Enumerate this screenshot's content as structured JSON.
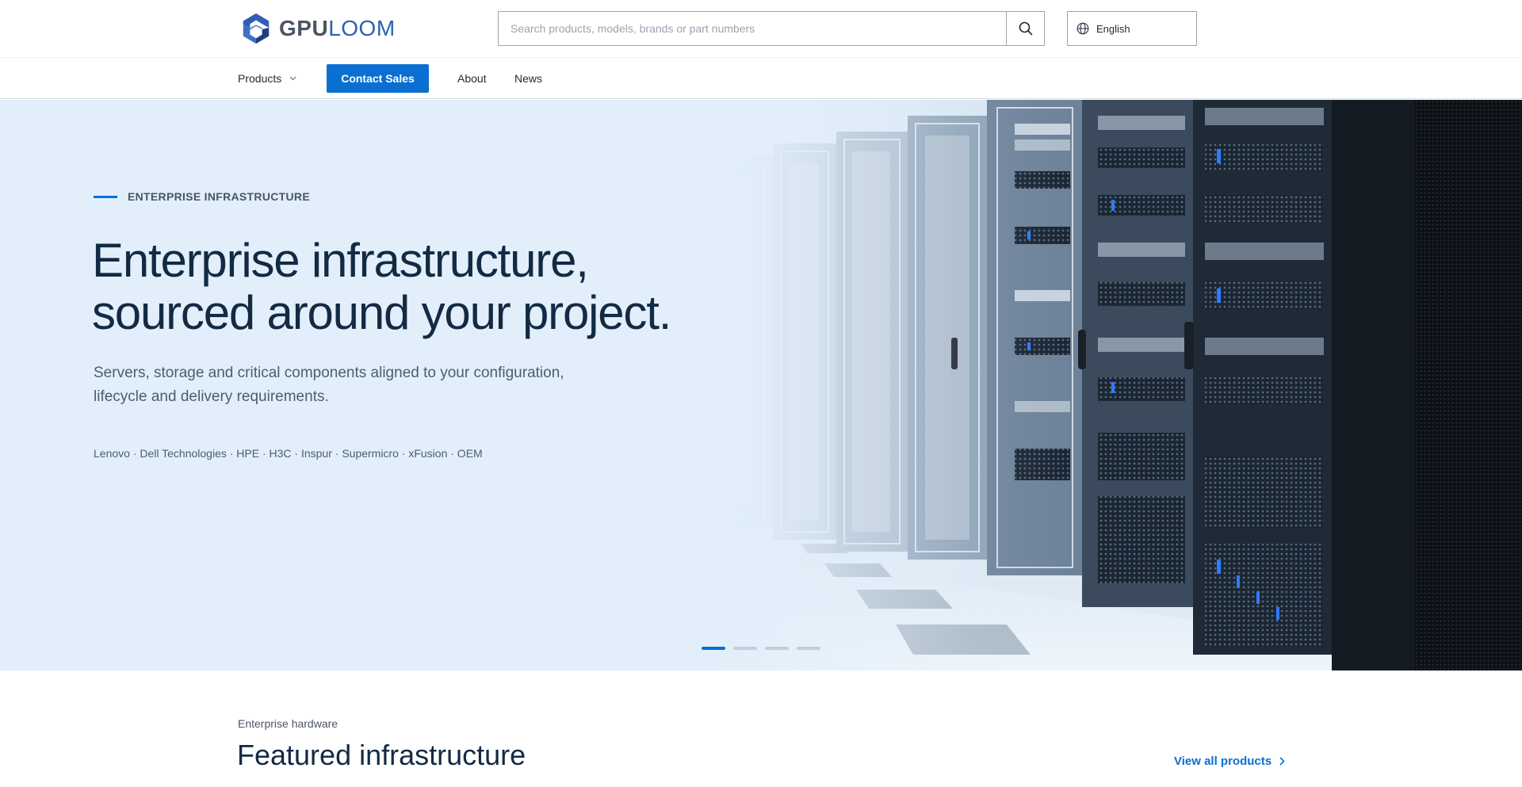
{
  "brand": {
    "logo_part1": "GPU",
    "logo_part2": "LOOM",
    "colors": {
      "primary": "#0a6fd1",
      "logo_dark": "#4b5563",
      "logo_blue": "#2f5fb3",
      "hero_bg": "#e2effa"
    }
  },
  "search": {
    "placeholder": "Search products, models, brands or part numbers",
    "value": "",
    "icon": "search-icon"
  },
  "language": {
    "selected": "English",
    "icon": "globe-icon"
  },
  "nav": {
    "products_label": "Products",
    "products_icon": "chevron-down-icon",
    "contact_label": "Contact Sales",
    "about_label": "About",
    "news_label": "News"
  },
  "hero": {
    "eyebrow": "ENTERPRISE INFRASTRUCTURE",
    "title_line1": "Enterprise infrastructure,",
    "title_line2": "sourced around your project.",
    "subtitle_line1": "Servers, storage and critical components aligned to your configuration,",
    "subtitle_line2": "lifecycle and delivery requirements.",
    "brands": "Lenovo · Dell Technologies · HPE · H3C · Inspur · Supermicro · xFusion · OEM",
    "image": "server-racks-datacenter",
    "carousel": {
      "slide_count": 4,
      "active_index": 0
    }
  },
  "featured": {
    "kicker": "Enterprise hardware",
    "title": "Featured infrastructure",
    "view_all_label": "View all products",
    "view_all_icon": "chevron-right-icon"
  }
}
